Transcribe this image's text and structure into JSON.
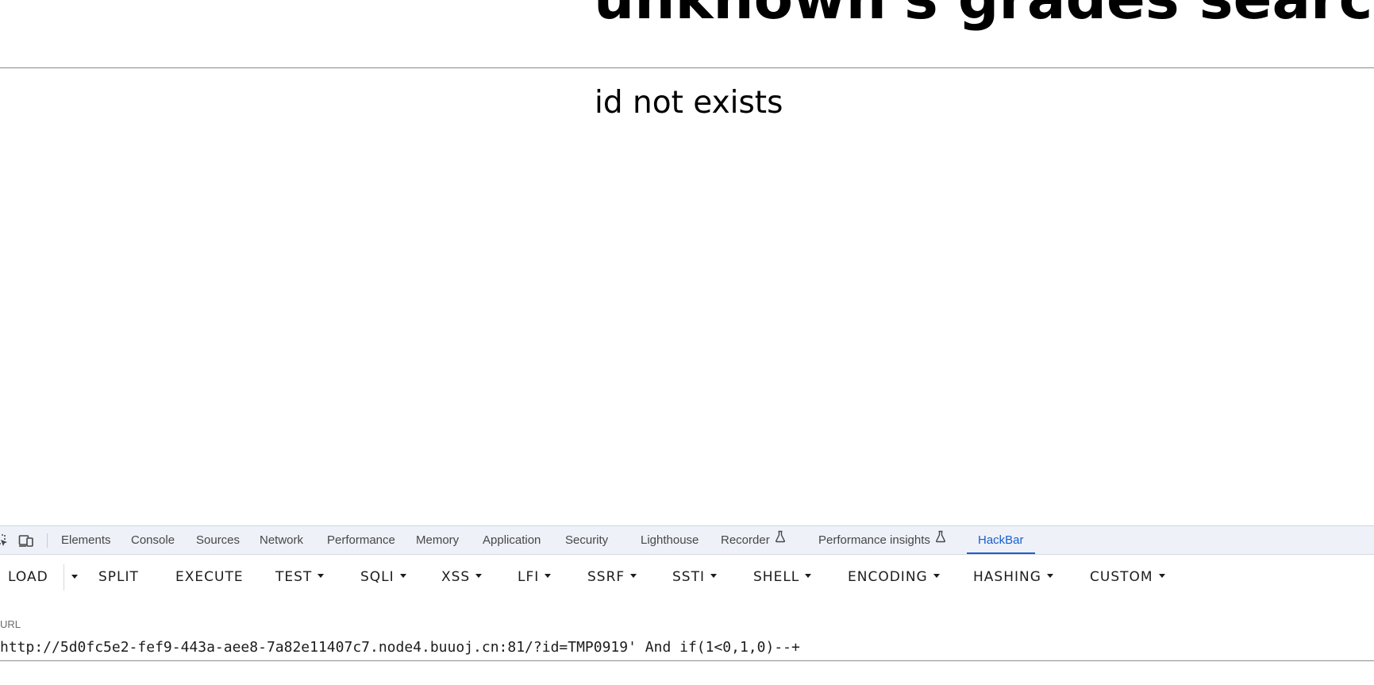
{
  "page": {
    "heading": "unknown's grades searching",
    "result_text": "id not exists"
  },
  "devtools": {
    "tabs": [
      {
        "label": "Elements"
      },
      {
        "label": "Console"
      },
      {
        "label": "Sources"
      },
      {
        "label": "Network"
      },
      {
        "label": "Performance"
      },
      {
        "label": "Memory"
      },
      {
        "label": "Application"
      },
      {
        "label": "Security"
      },
      {
        "label": "Lighthouse"
      },
      {
        "label": "Recorder",
        "icon": "flask-icon"
      },
      {
        "label": "Performance insights",
        "icon": "flask-icon"
      },
      {
        "label": "HackBar",
        "active": true
      }
    ],
    "accent_color": "#1a5fd0"
  },
  "hackbar": {
    "buttons": [
      {
        "label": "LOAD"
      },
      {
        "label": "SPLIT"
      },
      {
        "label": "EXECUTE"
      },
      {
        "label": "TEST",
        "dropdown": true
      },
      {
        "label": "SQLI",
        "dropdown": true
      },
      {
        "label": "XSS",
        "dropdown": true
      },
      {
        "label": "LFI",
        "dropdown": true
      },
      {
        "label": "SSRF",
        "dropdown": true
      },
      {
        "label": "SSTI",
        "dropdown": true
      },
      {
        "label": "SHELL",
        "dropdown": true
      },
      {
        "label": "ENCODING",
        "dropdown": true
      },
      {
        "label": "HASHING",
        "dropdown": true
      },
      {
        "label": "CUSTOM",
        "dropdown": true
      }
    ],
    "url_label": "URL",
    "url_value": "http://5d0fc5e2-fef9-443a-aee8-7a82e11407c7.node4.buuoj.cn:81/?id=TMP0919' And if(1<0,1,0)--+"
  }
}
